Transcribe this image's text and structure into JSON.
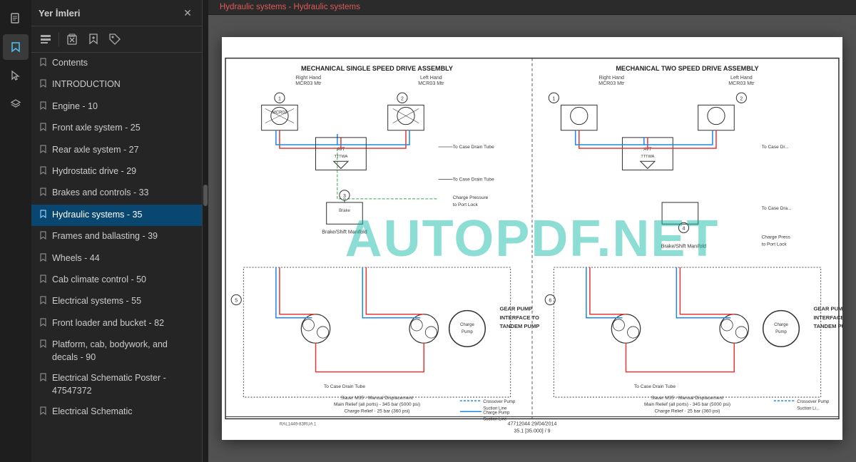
{
  "app": {
    "title": "Yer İmleri"
  },
  "icon_bar": {
    "icons": [
      {
        "name": "document-icon",
        "symbol": "📄"
      },
      {
        "name": "bookmark-panel-icon",
        "symbol": "🔖"
      },
      {
        "name": "cursor-icon",
        "symbol": "↖"
      },
      {
        "name": "layers-icon",
        "symbol": "⊞"
      }
    ]
  },
  "sidebar": {
    "title": "Yer İmleri",
    "toolbar": {
      "expand_label": "≡",
      "delete_label": "🗑",
      "bookmark_label": "🔖",
      "flag_label": "🏷"
    },
    "items": [
      {
        "id": "contents",
        "label": "Contents",
        "active": false
      },
      {
        "id": "introduction",
        "label": "INTRODUCTION",
        "active": false
      },
      {
        "id": "engine",
        "label": "Engine - 10",
        "active": false
      },
      {
        "id": "front-axle",
        "label": "Front axle system - 25",
        "active": false
      },
      {
        "id": "rear-axle",
        "label": "Rear axle system - 27",
        "active": false
      },
      {
        "id": "hydrostatic",
        "label": "Hydrostatic drive - 29",
        "active": false
      },
      {
        "id": "brakes",
        "label": "Brakes and controls - 33",
        "active": false
      },
      {
        "id": "hydraulic",
        "label": "Hydraulic systems - 35",
        "active": true
      },
      {
        "id": "frames",
        "label": "Frames and ballasting - 39",
        "active": false
      },
      {
        "id": "wheels",
        "label": "Wheels - 44",
        "active": false
      },
      {
        "id": "cab-climate",
        "label": "Cab climate control - 50",
        "active": false
      },
      {
        "id": "electrical",
        "label": "Electrical systems - 55",
        "active": false
      },
      {
        "id": "front-loader",
        "label": "Front loader and bucket - 82",
        "active": false
      },
      {
        "id": "platform",
        "label": "Platform, cab, bodywork, and decals - 90",
        "active": false
      },
      {
        "id": "elec-schematic-poster",
        "label": "Electrical Schematic Poster - 47547372",
        "active": false
      },
      {
        "id": "elec-schematic",
        "label": "Electrical Schematic",
        "active": false
      }
    ]
  },
  "page_header": {
    "breadcrumb": "Hydraulic systems - Hydraulic systems"
  },
  "pdf": {
    "watermark": "AUTOPDF.NET",
    "left_section_title": "MECHANICAL SINGLE SPEED DRIVE ASSEMBLY",
    "right_section_title": "MECHANICAL TWO SPEED DRIVE ASSEMBLY",
    "left_sub1": "Right Hand",
    "left_sub2": "MCR03 Mtr",
    "left_sub3": "Left Hand",
    "left_sub4": "MCR03 Mtr",
    "right_sub1": "Right Hand",
    "right_sub2": "MCR03 Mtr",
    "right_sub3": "Left Hand",
    "right_sub4": "MCR03 Mtr",
    "labels": [
      "Brake/Shift Manifold",
      "GEAR PUMP INTERFACE TO TANDEM PUMP",
      "Sauer M35 - Manual Displacement",
      "Main Relief (all ports) - 345 bar (5000 psi)",
      "Charge Relief - 25 bar (360 psi)",
      "Crossover Pump Suction Line",
      "Charge Pump Suction Line"
    ],
    "page_number": "47712044 29/04/2014",
    "page_ref": "35.1 [35.000] / 9"
  }
}
